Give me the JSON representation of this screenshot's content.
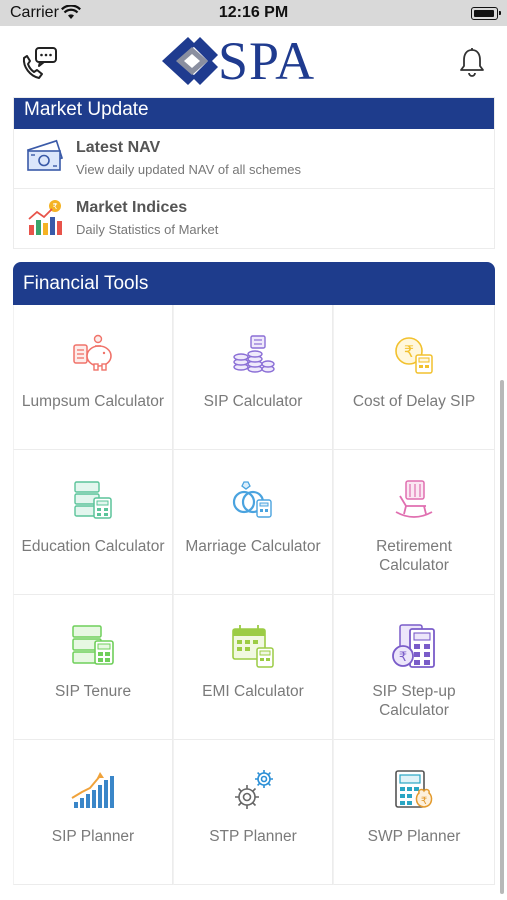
{
  "status_bar": {
    "carrier": "Carrier",
    "time": "12:16 PM"
  },
  "header": {
    "logo_text": "SPA",
    "support_icon": "phone-chat-icon",
    "bell_icon": "bell-icon"
  },
  "market_update": {
    "title": "Market Update",
    "items": [
      {
        "title": "Latest NAV",
        "subtitle": "View daily updated NAV of all schemes",
        "icon": "money-notes-icon"
      },
      {
        "title": "Market Indices",
        "subtitle": "Daily Statistics of Market",
        "icon": "chart-bars-icon"
      }
    ]
  },
  "financial_tools": {
    "title": "Financial Tools",
    "tools": [
      {
        "label": "Lumpsum Calculator",
        "icon": "piggy-bank-icon",
        "color": "#f0736a"
      },
      {
        "label": "SIP Calculator",
        "icon": "coins-stack-icon",
        "color": "#8b6fd6"
      },
      {
        "label": "Cost of Delay SIP",
        "icon": "rupee-clock-icon",
        "color": "#f2c12e"
      },
      {
        "label": "Education Calculator",
        "icon": "education-icon",
        "color": "#5bc49a"
      },
      {
        "label": "Marriage Calculator",
        "icon": "rings-icon",
        "color": "#4aa3df"
      },
      {
        "label": "Retirement Calculator",
        "icon": "rocking-chair-icon",
        "color": "#e06fb0"
      },
      {
        "label": "SIP Tenure",
        "icon": "tenure-icon",
        "color": "#6fcf5a"
      },
      {
        "label": "EMI Calculator",
        "icon": "calendar-calc-icon",
        "color": "#9ccc45"
      },
      {
        "label": "SIP Step-up Calculator",
        "icon": "stepup-calculator-icon",
        "color": "#7a5cc9"
      },
      {
        "label": "SIP Planner",
        "icon": "growth-chart-icon",
        "color": "#3a86c8"
      },
      {
        "label": "STP Planner",
        "icon": "gears-icon",
        "color": "#2b8fd6"
      },
      {
        "label": "SWP Planner",
        "icon": "rupee-calculator-icon",
        "color": "#2aa6c4"
      }
    ]
  },
  "colors": {
    "primary": "#1e3c8c",
    "logo": "#1f3b8f"
  }
}
